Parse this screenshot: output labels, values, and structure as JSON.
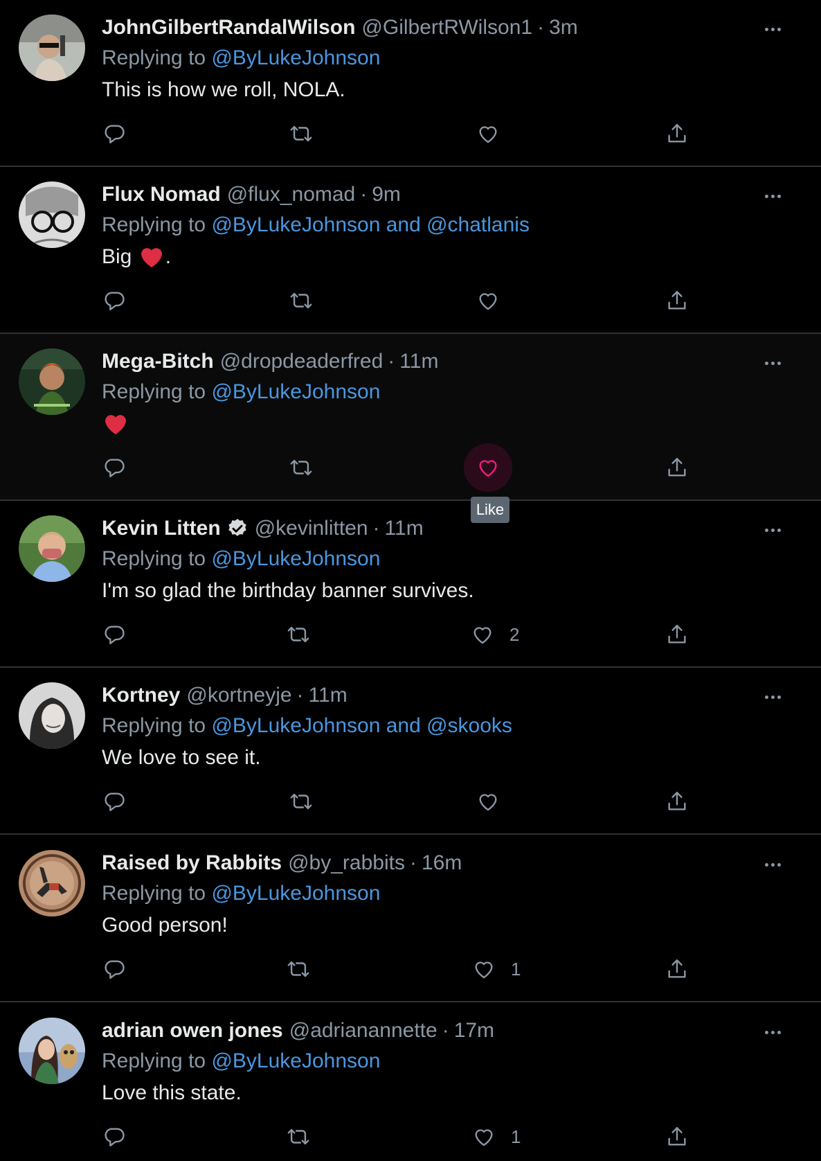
{
  "colors": {
    "background": "#000000",
    "hover_background": "#0a0a0a",
    "text": "#e7e9ea",
    "secondary_text": "#8b98a5",
    "link": "#4a97e0",
    "like_active": "#f91880",
    "divider": "#2f3336"
  },
  "tooltip": {
    "label": "Like"
  },
  "tweets": [
    {
      "name": "JohnGilbertRandalWilson",
      "handle": "@GilbertRWilson1",
      "separator": "·",
      "time": "3m",
      "replying_prefix": "Replying to ",
      "replying_to": "@ByLukeJohnson",
      "text": "This is how we roll, NOLA.",
      "like_count": ""
    },
    {
      "name": "Flux Nomad",
      "handle": "@flux_nomad",
      "separator": "·",
      "time": "9m",
      "replying_prefix": "Replying to ",
      "replying_to": "@ByLukeJohnson and @chatlanis",
      "text_before": "Big ",
      "text_emoji": "red-heart",
      "text_after": ".",
      "like_count": ""
    },
    {
      "name": "Mega-Bitch",
      "handle": "@dropdeaderfred",
      "separator": "·",
      "time": "11m",
      "replying_prefix": "Replying to ",
      "replying_to": "@ByLukeJohnson",
      "text_emoji": "red-heart",
      "like_count": "",
      "hovered": true
    },
    {
      "name": "Kevin Litten",
      "verified": true,
      "handle": "@kevinlitten",
      "separator": "·",
      "time": "11m",
      "replying_prefix": "Replying to ",
      "replying_to": "@ByLukeJohnson",
      "text": "I'm so glad the birthday banner survives.",
      "like_count": "2"
    },
    {
      "name": "Kortney",
      "handle": "@kortneyje",
      "separator": "·",
      "time": "11m",
      "replying_prefix": "Replying to ",
      "replying_to": "@ByLukeJohnson and @skooks",
      "text": "We love to see it.",
      "like_count": ""
    },
    {
      "name": "Raised by Rabbits",
      "handle": "@by_rabbits",
      "separator": "·",
      "time": "16m",
      "replying_prefix": "Replying to ",
      "replying_to": "@ByLukeJohnson",
      "text": "Good person!",
      "like_count": "1"
    },
    {
      "name": "adrian owen jones",
      "handle": "@adrianannette",
      "separator": "·",
      "time": "17m",
      "replying_prefix": "Replying to ",
      "replying_to": "@ByLukeJohnson",
      "text": "Love this state.",
      "like_count": "1"
    }
  ]
}
